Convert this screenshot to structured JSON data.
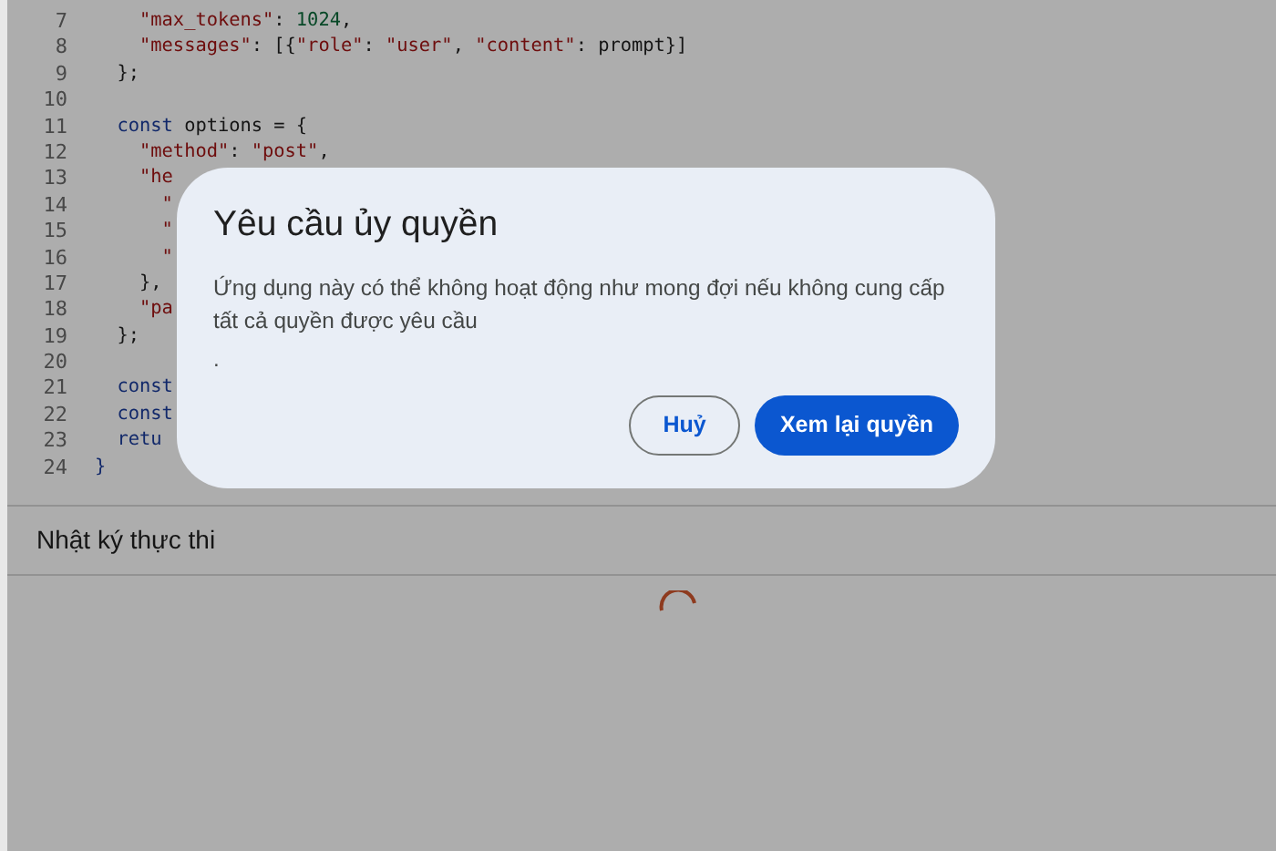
{
  "editor": {
    "lines": [
      {
        "number": "7",
        "tokens": [
          {
            "kind": "string",
            "text": "    \"max_tokens\""
          },
          {
            "kind": "plain",
            "text": ": "
          },
          {
            "kind": "number",
            "text": "1024"
          },
          {
            "kind": "plain",
            "text": ","
          }
        ]
      },
      {
        "number": "8",
        "tokens": [
          {
            "kind": "string",
            "text": "    \"messages\""
          },
          {
            "kind": "plain",
            "text": ": [{"
          },
          {
            "kind": "string",
            "text": "\"role\""
          },
          {
            "kind": "plain",
            "text": ": "
          },
          {
            "kind": "string",
            "text": "\"user\""
          },
          {
            "kind": "plain",
            "text": ", "
          },
          {
            "kind": "string",
            "text": "\"content\""
          },
          {
            "kind": "plain",
            "text": ": prompt}]"
          }
        ]
      },
      {
        "number": "9",
        "tokens": [
          {
            "kind": "plain",
            "text": "  };"
          }
        ]
      },
      {
        "number": "10"
      },
      {
        "number": "11",
        "tokens": [
          {
            "kind": "keyword",
            "text": "  const"
          },
          {
            "kind": "plain",
            "text": " options = {"
          }
        ]
      },
      {
        "number": "12",
        "tokens": [
          {
            "kind": "string",
            "text": "    \"method\""
          },
          {
            "kind": "plain",
            "text": ": "
          },
          {
            "kind": "string",
            "text": "\"post\""
          },
          {
            "kind": "plain",
            "text": ","
          }
        ]
      },
      {
        "number": "13",
        "tokens": [
          {
            "kind": "string",
            "text": "    \"he"
          }
        ]
      },
      {
        "number": "14",
        "tokens": [
          {
            "kind": "string",
            "text": "      \""
          }
        ]
      },
      {
        "number": "15",
        "tokens": [
          {
            "kind": "string",
            "text": "      \""
          }
        ]
      },
      {
        "number": "16",
        "tokens": [
          {
            "kind": "string",
            "text": "      \""
          }
        ]
      },
      {
        "number": "17",
        "tokens": [
          {
            "kind": "plain",
            "text": "    },"
          }
        ]
      },
      {
        "number": "18",
        "tokens": [
          {
            "kind": "string",
            "text": "    \"pa"
          }
        ]
      },
      {
        "number": "19",
        "tokens": [
          {
            "kind": "plain",
            "text": "  };"
          }
        ]
      },
      {
        "number": "20"
      },
      {
        "number": "21",
        "tokens": [
          {
            "kind": "keyword",
            "text": "  const"
          }
        ]
      },
      {
        "number": "22",
        "tokens": [
          {
            "kind": "keyword",
            "text": "  const"
          }
        ]
      },
      {
        "number": "23",
        "tokens": [
          {
            "kind": "keyword",
            "text": "  retu"
          }
        ]
      },
      {
        "number": "24",
        "tokens": [
          {
            "kind": "keyword",
            "text": "}"
          }
        ]
      }
    ]
  },
  "log_panel": {
    "title": "Nhật ký thực thi",
    "loading": true
  },
  "dialog": {
    "title": "Yêu cầu ủy quyền",
    "message": "Ứng dụng này có thể không hoạt động như mong đợi nếu không cung cấp tất cả quyền được yêu cầu",
    "footnote": ".",
    "buttons": [
      {
        "label": "Huỷ",
        "kind": "outlined"
      },
      {
        "label": "Xem lại quyền",
        "kind": "filled"
      }
    ]
  }
}
